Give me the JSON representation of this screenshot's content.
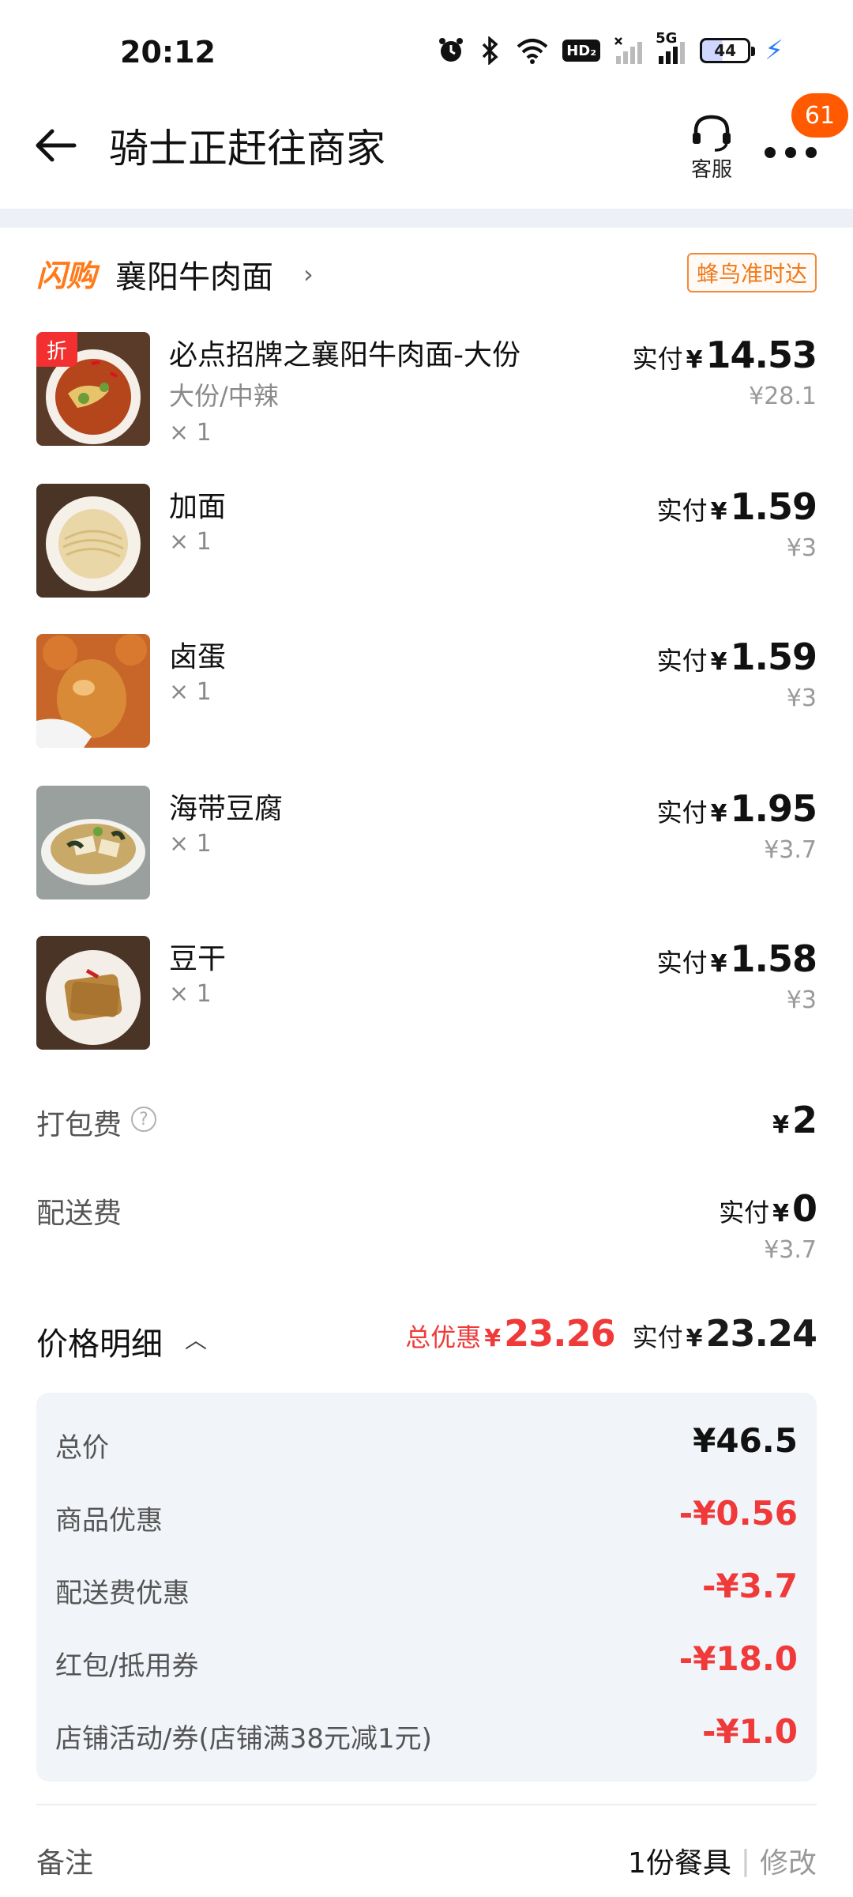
{
  "status_bar": {
    "time": "20:12",
    "hd_label": "HD₂",
    "network": "5G",
    "battery": "44"
  },
  "header": {
    "title": "骑士正赶往商家",
    "service_label": "客服",
    "badge_count": "61"
  },
  "store": {
    "brand": "闪购",
    "name": "襄阳牛肉面",
    "chevron": "›",
    "ontime_badge": "蜂鸟准时达"
  },
  "currency": "¥",
  "pay_label": "实付",
  "items": [
    {
      "tag": "折",
      "name": "必点招牌之襄阳牛肉面-大份",
      "spec": "大份/中辣",
      "qty": "× 1",
      "price": "14.53",
      "orig": "¥28.1",
      "icon": "beef-noodle-bowl"
    },
    {
      "name": "加面",
      "qty": "× 1",
      "price": "1.59",
      "orig": "¥3",
      "icon": "plain-noodles"
    },
    {
      "name": "卤蛋",
      "qty": "× 1",
      "price": "1.59",
      "orig": "¥3",
      "icon": "braised-egg"
    },
    {
      "name": "海带豆腐",
      "qty": "× 1",
      "price": "1.95",
      "orig": "¥3.7",
      "icon": "kelp-tofu-soup"
    },
    {
      "name": "豆干",
      "qty": "× 1",
      "price": "1.58",
      "orig": "¥3",
      "icon": "dried-tofu"
    }
  ],
  "packing_fee": {
    "label": "打包费",
    "help": "?",
    "amount": "2"
  },
  "delivery_fee": {
    "label": "配送费",
    "amount": "0",
    "orig": "¥3.7"
  },
  "price_detail": {
    "title": "价格明细",
    "caret": "︿",
    "total_discount_label": "总优惠",
    "total_discount": "23.26",
    "paid": "23.24",
    "rows": [
      {
        "label": "总价",
        "value": "¥46.5",
        "negative": false
      },
      {
        "label": "商品优惠",
        "value": "-¥0.56",
        "negative": true
      },
      {
        "label": "配送费优惠",
        "value": "-¥3.7",
        "negative": true
      },
      {
        "label": "红包/抵用券",
        "value": "-¥18.0",
        "negative": true
      },
      {
        "label": "店铺活动/券(店铺满38元减1元)",
        "value": "-¥1.0",
        "negative": true
      }
    ]
  },
  "note": {
    "label": "备注",
    "value": "1份餐具",
    "separator": "|",
    "edit": "修改"
  }
}
